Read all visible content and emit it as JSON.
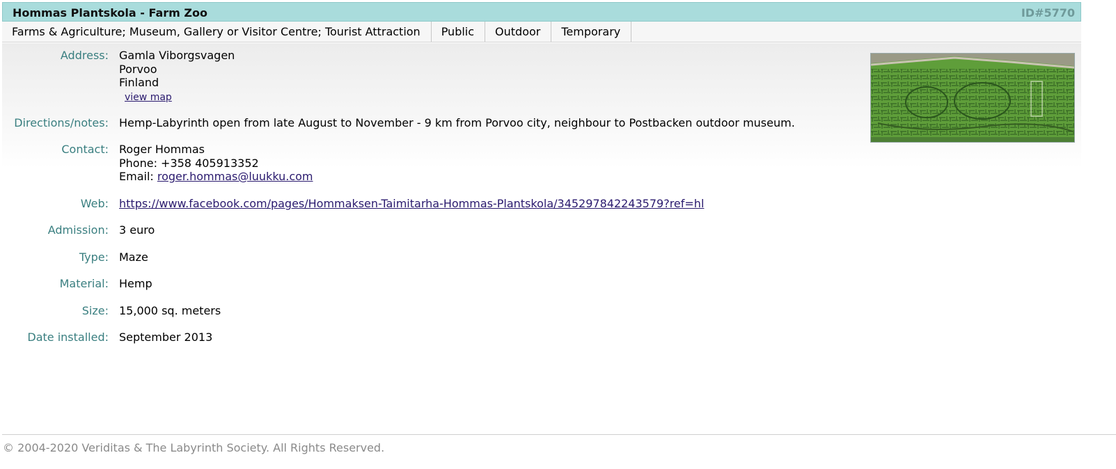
{
  "header": {
    "title": "Hommas Plantskola - Farm Zoo",
    "id": "ID#5770"
  },
  "tags": [
    "Farms & Agriculture; Museum, Gallery or Visitor Centre; Tourist Attraction",
    "Public",
    "Outdoor",
    "Temporary"
  ],
  "details": {
    "address_label": "Address:",
    "address_lines": [
      "Gamla Viborgsvagen",
      "Porvoo",
      "Finland"
    ],
    "view_map": "view map",
    "directions_label": "Directions/notes:",
    "directions": "Hemp-Labyrinth open from late August to November - 9 km from Porvoo city, neighbour to Postbacken outdoor museum.",
    "contact_label": "Contact:",
    "contact_name": "Roger Hommas",
    "contact_phone": "Phone: +358 405913352",
    "contact_email_prefix": "Email: ",
    "contact_email": "roger.hommas@luukku.com",
    "web_label": "Web:",
    "web": "https://www.facebook.com/pages/Hommaksen-Taimitarha-Hommas-Plantskola/345297842243579?ref=hl",
    "admission_label": "Admission:",
    "admission": "3 euro",
    "type_label": "Type:",
    "type": "Maze",
    "material_label": "Material:",
    "material": "Hemp",
    "size_label": "Size:",
    "size": "15,000 sq. meters",
    "date_label": "Date installed:",
    "date": "September 2013"
  },
  "photo": {
    "icon": "aerial-maze-photo",
    "colors": {
      "field": "#5f9e3a",
      "dark_path": "#2f5e20",
      "road": "#b9b6a8"
    }
  },
  "footer": {
    "copyright": "© 2004-2020 Veriditas & The Labyrinth Society. All Rights Reserved."
  },
  "colors": {
    "title_bar": "#a9dcdc",
    "label": "#3a7f80",
    "link": "#2a1a6e",
    "footer_text": "#8a8a8a"
  }
}
